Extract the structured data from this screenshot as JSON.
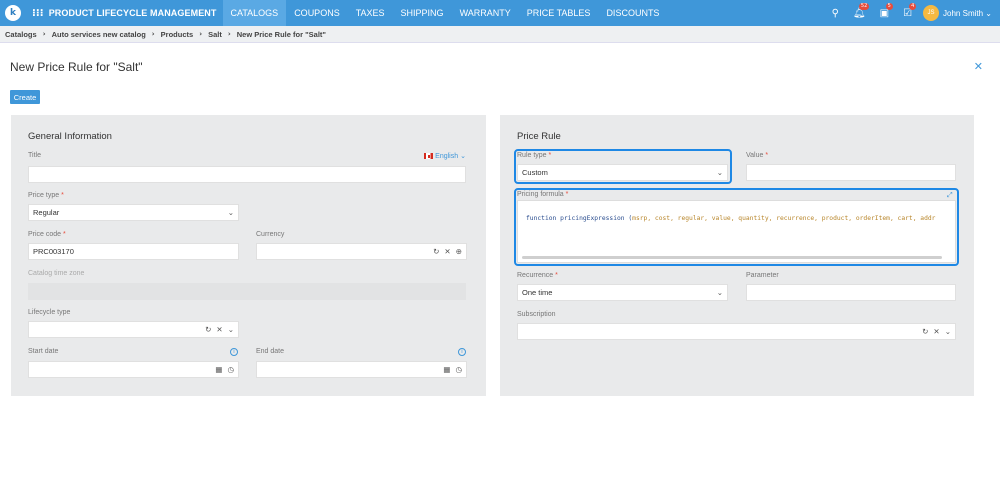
{
  "header": {
    "logo_letter": "k",
    "app_name": "PRODUCT LIFECYCLE MANAGEMENT",
    "nav": [
      "CATALOGS",
      "COUPONS",
      "TAXES",
      "SHIPPING",
      "WARRANTY",
      "PRICE TABLES",
      "DISCOUNTS"
    ],
    "active_nav": "CATALOGS",
    "badges": {
      "notifications": "52",
      "tasks": "5",
      "approvals": "4"
    },
    "user_initials": "JS",
    "user_name": "John Smith"
  },
  "breadcrumb": [
    "Catalogs",
    "Auto services new catalog",
    "Products",
    "Salt",
    "New Price Rule for \"Salt\""
  ],
  "page": {
    "title": "New Price Rule for \"Salt\"",
    "create_label": "Create"
  },
  "general": {
    "heading": "General Information",
    "title_label": "Title",
    "language": "English",
    "title_value": "",
    "price_type_label": "Price type",
    "price_type_value": "Regular",
    "price_code_label": "Price code",
    "price_code_value": "PRC003170",
    "currency_label": "Currency",
    "currency_value": "",
    "tz_label": "Catalog time zone",
    "lifecycle_label": "Lifecycle type",
    "start_label": "Start date",
    "end_label": "End date"
  },
  "rule": {
    "heading": "Price Rule",
    "rule_type_label": "Rule type",
    "rule_type_value": "Custom",
    "value_label": "Value",
    "formula_label": "Pricing formula",
    "formula_keyword": "function pricingExpression (",
    "formula_args": "msrp, cost, regular, value, quantity, recurrence, product, orderItem, cart, addr",
    "recurrence_label": "Recurrence",
    "recurrence_value": "One time",
    "parameter_label": "Parameter",
    "subscription_label": "Subscription"
  },
  "colors": {
    "primary": "#3f97d9",
    "highlight": "#1e88e5",
    "required": "#e74c3c",
    "panel": "#e9eaeb"
  },
  "icons": [
    "search-icon",
    "bell-icon",
    "tasks-icon",
    "approvals-icon",
    "chevron-down-icon",
    "refresh-icon",
    "clear-icon",
    "add-icon",
    "calendar-icon",
    "clock-icon",
    "info-icon",
    "close-icon",
    "expand-icon"
  ]
}
